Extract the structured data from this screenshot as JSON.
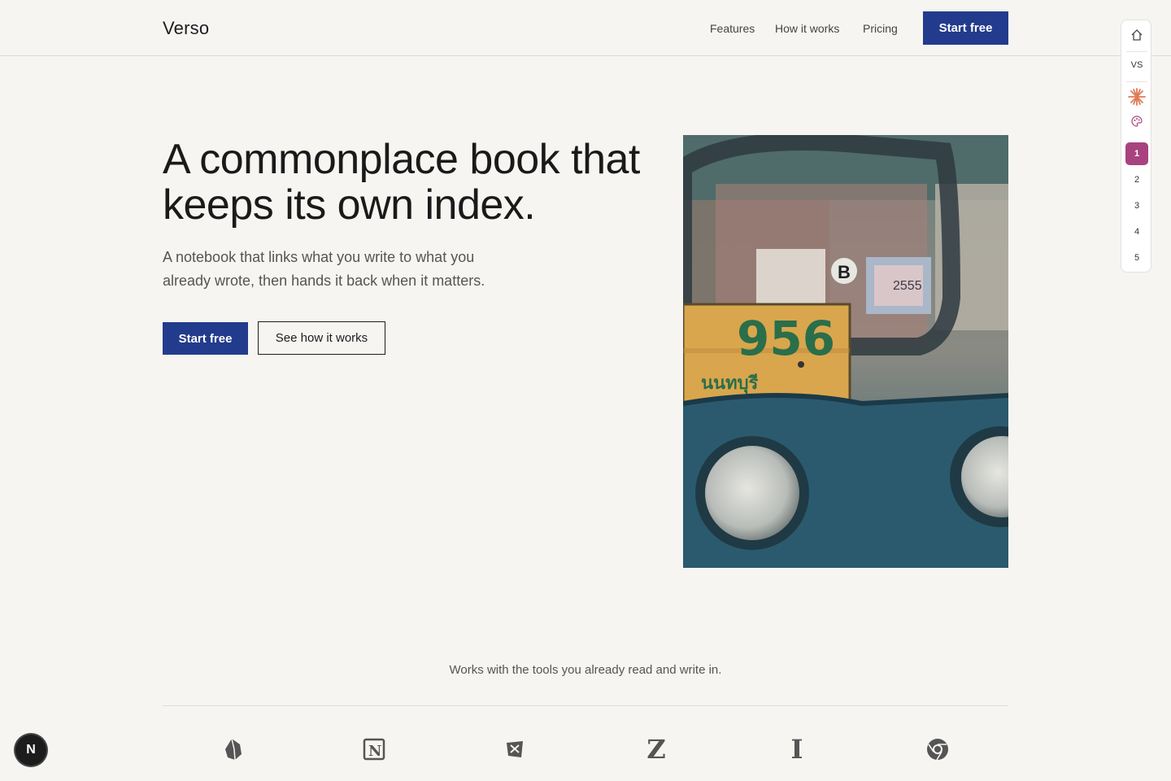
{
  "header": {
    "logo": "Verso",
    "nav": [
      "Features",
      "How it works",
      "Pricing"
    ],
    "cta": "Start free"
  },
  "hero": {
    "headline": "A commonplace book that keeps its own index.",
    "subhead": "A notebook that links what you write to what you already wrote, then hands it back when it matters.",
    "primary_cta": "Start free",
    "secondary_cta": "See how it works",
    "image_plate_text": "956",
    "image_sticker_text": "2555",
    "image_letter": "B",
    "image_script_text": "นนทบุรี"
  },
  "tools": {
    "caption": "Works with the tools you already read and write in.",
    "logos": [
      {
        "icon": "obsidian-icon"
      },
      {
        "icon": "notion-icon",
        "glyph": "N"
      },
      {
        "icon": "readwise-icon"
      },
      {
        "icon": "zotero-icon",
        "glyph": "Z"
      },
      {
        "icon": "instapaper-icon",
        "glyph": "I"
      },
      {
        "icon": "chrome-icon"
      }
    ]
  },
  "sidebar": {
    "home": "home-icon",
    "vs_label": "VS",
    "sparkle": "sparkle-icon",
    "palette": "palette-icon",
    "pages": [
      "1",
      "2",
      "3",
      "4",
      "5"
    ],
    "active_page": "1",
    "accent": "#a8437f"
  },
  "badge": {
    "letter": "N"
  },
  "colors": {
    "primary": "#233b8c",
    "background": "#f6f5f2",
    "text": "#1d1d1f"
  }
}
